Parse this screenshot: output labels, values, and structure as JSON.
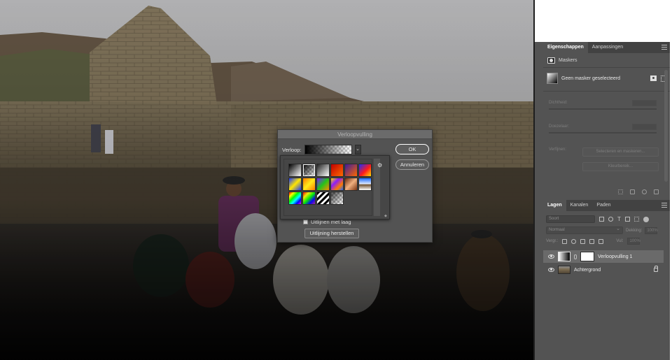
{
  "dialog": {
    "title": "Verloopvulling",
    "gradient_label": "Verloop:",
    "ok_label": "OK",
    "cancel_label": "Annuleren",
    "align_label": "Uitlijnen met laag",
    "reset_label": "Uitlijning herstellen",
    "dropdown_glyph": "⌄",
    "gear_glyph": "⚙",
    "swatches": [
      {
        "name": "black-white",
        "css": "linear-gradient(135deg,#000 0%,#fff 100%)"
      },
      {
        "name": "black-transparent",
        "css": "linear-gradient(135deg,#000 0%,rgba(0,0,0,0) 100%), repeating-conic-gradient(#bbb 0% 25%, #fff 0% 50%) 0 0/6px 6px"
      },
      {
        "name": "black-white-2",
        "css": "linear-gradient(135deg,#222 0%,#fff 100%)"
      },
      {
        "name": "red-orange",
        "css": "linear-gradient(135deg,#c00000 0%,#ff6a00 100%)"
      },
      {
        "name": "violet-orange",
        "css": "linear-gradient(135deg,#3b1c9c 0%,#ff6600 100%)"
      },
      {
        "name": "blue-red-yellow",
        "css": "linear-gradient(135deg,#1e2cff 0%,#ff1a1a 55%,#ffe000 100%)"
      },
      {
        "name": "blue-yellow-blue",
        "css": "linear-gradient(135deg,#1a38ff 0%,#ffe600 50%,#1a38ff 100%)"
      },
      {
        "name": "orange-yellow-orange",
        "css": "linear-gradient(135deg,#ff7a00 0%,#ffec1a 50%,#ff7a00 100%)"
      },
      {
        "name": "violet-green-orange",
        "css": "linear-gradient(135deg,#7a1cff 0%,#23c41a 50%,#ff8c00 100%)"
      },
      {
        "name": "yellow-violet-orange-blue",
        "css": "linear-gradient(135deg,#ffe000 0%,#8a1cff 35%,#ff7a00 70%,#1a6aff 100%)"
      },
      {
        "name": "copper",
        "css": "linear-gradient(135deg,#6a2a0a 0%,#f0b080 50%,#7a3412 100%)"
      },
      {
        "name": "chrome",
        "css": "linear-gradient(180deg,#1a6aff 0%,#e8f0ff 50%,#6a4a2a 52%,#ffffff 100%)"
      },
      {
        "name": "spectrum",
        "css": "linear-gradient(135deg,#ff0000 0%,#ffff00 20%,#00ff00 40%,#00ffff 60%,#0000ff 80%,#ff00ff 100%)"
      },
      {
        "name": "transparent-rainbow",
        "css": "linear-gradient(135deg,rgba(255,0,0,0.9) 0%,rgba(255,255,0,0.9) 25%,rgba(0,255,0,0.9) 50%,rgba(0,0,255,0.9) 75%,rgba(255,0,255,0.5) 100%)"
      },
      {
        "name": "transparent-stripes",
        "css": "repeating-linear-gradient(135deg,#000 0 3px,#fff 3px 6px)"
      },
      {
        "name": "neutral-density",
        "css": "linear-gradient(135deg,rgba(0,0,0,0.7) 0%,rgba(0,0,0,0) 100%), repeating-conic-gradient(#bbb 0% 25%, #fff 0% 50%) 0 0/6px 6px"
      }
    ]
  },
  "properties": {
    "tabs": [
      {
        "label": "Eigenschappen"
      },
      {
        "label": "Aanpassingen"
      }
    ],
    "header": "Maskers",
    "mask_status": "Geen masker geselecteerd",
    "density_label": "Dichtheid:",
    "feather_label": "Doezelaar:",
    "refine_label": "Verfijnen:",
    "select_mask_label": "Selecteren en maskeren...",
    "color_range_label": "Kleurbereik..."
  },
  "layers": {
    "tabs": [
      {
        "label": "Lagen"
      },
      {
        "label": "Kanalen"
      },
      {
        "label": "Paden"
      }
    ],
    "search_placeholder": "Soort",
    "blend_mode": "Normaal",
    "opacity_label": "Dekking:",
    "opacity_value": "100%",
    "lock_label": "Vergr.:",
    "fill_label": "Vul:",
    "fill_value": "100%",
    "items": [
      {
        "name": "Verloopvulling 1",
        "selected": true
      },
      {
        "name": "Achtergrond",
        "selected": false
      }
    ]
  }
}
